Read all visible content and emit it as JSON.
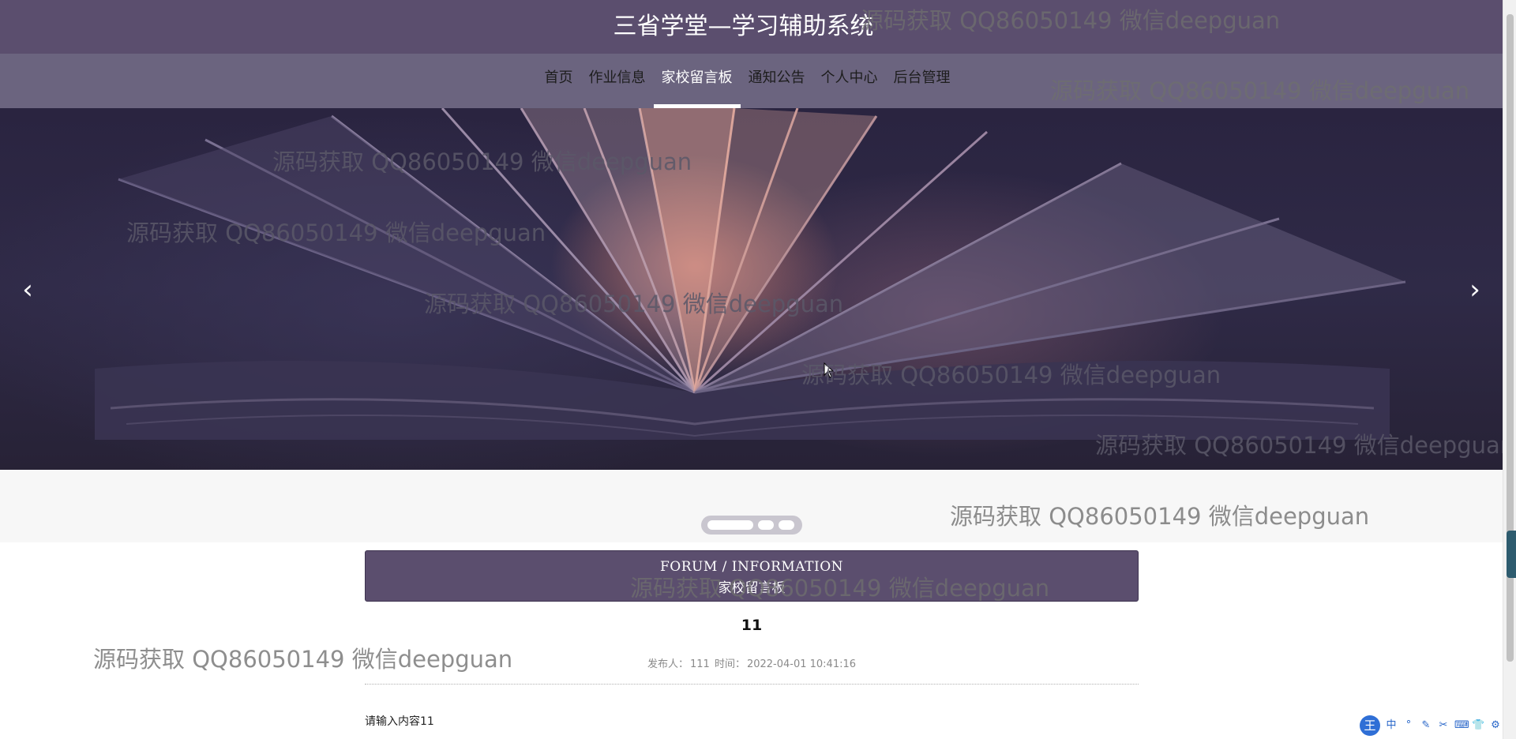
{
  "site": {
    "title": "三省学堂—学习辅助系统"
  },
  "nav": {
    "items": [
      {
        "label": "首页"
      },
      {
        "label": "作业信息"
      },
      {
        "label": "家校留言板",
        "active": true
      },
      {
        "label": "通知公告"
      },
      {
        "label": "个人中心"
      },
      {
        "label": "后台管理"
      }
    ]
  },
  "carousel": {
    "prev_icon": "‹",
    "next_icon": "›",
    "slide_count": 3,
    "active_slide": 1
  },
  "forum": {
    "heading_en": "FORUM / INFORMATION",
    "heading_cn": "家校留言板"
  },
  "post": {
    "title": "11",
    "author_label": "发布人：",
    "author": "111",
    "time_label": "时间：",
    "time": "2022-04-01 10:41:16",
    "content": "请输入内容11"
  },
  "watermark": {
    "text": "源码获取 QQ86050149 微信deepguan"
  },
  "ime": {
    "logo": "王",
    "items": [
      "中",
      "°",
      "✎",
      "✂",
      "⌨",
      "👕",
      "⚙"
    ]
  },
  "colors": {
    "header": "#5b4e6e",
    "nav": "#6b647f",
    "accent_white": "#ffffff"
  }
}
